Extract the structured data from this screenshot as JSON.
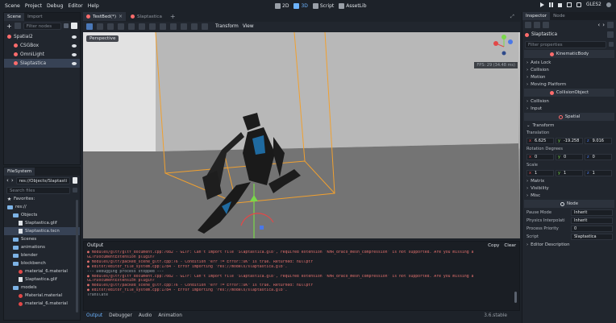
{
  "menu": [
    "Scene",
    "Project",
    "Debug",
    "Editor",
    "Help"
  ],
  "workspaces": [
    {
      "label": "2D",
      "active": false
    },
    {
      "label": "3D",
      "active": true
    },
    {
      "label": "Script",
      "active": false
    },
    {
      "label": "AssetLib",
      "active": false
    }
  ],
  "renderer": "GLES2",
  "scene_dock": {
    "tabs": [
      "Scene",
      "Import"
    ],
    "filter_placeholder": "Filter nodes",
    "tree": [
      {
        "label": "Spatial2",
        "indent": 0,
        "icon_color": "#ff6c6c",
        "selected": false
      },
      {
        "label": "CSGBox",
        "indent": 1,
        "icon_color": "#ff6c6c",
        "selected": false
      },
      {
        "label": "OmniLight",
        "indent": 1,
        "icon_color": "#ff6c6c",
        "selected": false
      },
      {
        "label": "Slaptastica",
        "indent": 1,
        "icon_color": "#ff6c6c",
        "selected": true
      }
    ]
  },
  "filesystem": {
    "tab": "FileSystem",
    "path": "res://Objects/Slaptasti",
    "search_placeholder": "Search files",
    "items": [
      {
        "label": "Favorites:",
        "indent": 0,
        "kind": "star",
        "selected": false
      },
      {
        "label": "res://",
        "indent": 0,
        "kind": "folder",
        "selected": false
      },
      {
        "label": "Objects",
        "indent": 1,
        "kind": "folder",
        "selected": false
      },
      {
        "label": "Slaptastica.glif",
        "indent": 2,
        "kind": "file",
        "selected": false
      },
      {
        "label": "Slaptastica.tscn",
        "indent": 2,
        "kind": "file",
        "selected": true
      },
      {
        "label": "Scenes",
        "indent": 1,
        "kind": "folder",
        "selected": false
      },
      {
        "label": "animations",
        "indent": 1,
        "kind": "folder",
        "selected": false
      },
      {
        "label": "blender",
        "indent": 1,
        "kind": "folder",
        "selected": false
      },
      {
        "label": "blockbench",
        "indent": 1,
        "kind": "folder",
        "selected": false
      },
      {
        "label": "material_6.material",
        "indent": 2,
        "kind": "res",
        "selected": false
      },
      {
        "label": "Slaptastica.glif",
        "indent": 2,
        "kind": "file",
        "selected": false
      },
      {
        "label": "models",
        "indent": 1,
        "kind": "folder",
        "selected": false
      },
      {
        "label": "Material.material",
        "indent": 2,
        "kind": "res",
        "selected": false
      },
      {
        "label": "material_6.material",
        "indent": 2,
        "kind": "res",
        "selected": false
      }
    ]
  },
  "scene_tabs": [
    "TestBed(*)",
    "Slaptastica"
  ],
  "viewport_toolbar": {
    "transform": "Transform",
    "view": "View"
  },
  "viewport": {
    "perspective": "Perspective",
    "fps": "FPS: 29 (34.48 ms)"
  },
  "output": {
    "title": "Output",
    "copy": "Copy",
    "clear": "Clear",
    "lines": [
      {
        "text": "● modules/gltf/gltf_document.cpp:7082 - GLTF: Can't import file 'Slaptastica.glb', required extension 'KHR_draco_mesh_compression' is not supported. Are you missing a",
        "err": true
      },
      {
        "text": "GLTFDocumentExtension plugin?",
        "err": true
      },
      {
        "text": "● modules/gltf/packed_scene_gltf.cpp:76 - Condition \"err != Error::OK\" is true. Returned: nullptr",
        "err": true
      },
      {
        "text": "● editor/editor_file_system.cpp:1784 - Error importing 'res://models/slaptastica.glb'.",
        "err": true
      },
      {
        "text": "--- Debugging process stopped ---",
        "err": false
      },
      {
        "text": "● modules/gltf/gltf_document.cpp:7082 - GLTF: Can't import file 'Slaptastica.glb', required extension 'KHR_draco_mesh_compression' is not supported. Are you missing a",
        "err": true
      },
      {
        "text": "GLTFDocumentExtension plugin?",
        "err": true
      },
      {
        "text": "● modules/gltf/packed_scene_gltf.cpp:76 - Condition \"err != Error::OK\" is true. Returned: nullptr",
        "err": true
      },
      {
        "text": "● editor/editor_file_system.cpp:1784 - Error importing 'res://models/slaptastica.glb'.",
        "err": true
      },
      {
        "text": "Translate",
        "err": false
      }
    ]
  },
  "bottom_tabs": [
    "Output",
    "Debugger",
    "Audio",
    "Animation"
  ],
  "version": "3.6.stable",
  "inspector": {
    "tabs": [
      "Inspector",
      "Node"
    ],
    "object": "Slaptastica",
    "filter_placeholder": "Filter properties",
    "class_header": "KinematicBody",
    "sections1": [
      "Axis Lock",
      "Collision",
      "Motion",
      "Moving Platform"
    ],
    "class_header2": "CollisionObject",
    "sections2": [
      "Collision",
      "Input"
    ],
    "class_header3": "Spatial",
    "transform_label": "Transform",
    "translation_label": "Translation",
    "translation": {
      "x": "6.625",
      "y": "-19.258",
      "z": "9.016"
    },
    "rotation_label": "Rotation Degrees",
    "rotation": {
      "x": "0",
      "y": "0",
      "z": "0"
    },
    "scale_label": "Scale",
    "scale": {
      "x": "1",
      "y": "1",
      "z": "1"
    },
    "sections3": [
      "Matrix",
      "Visibility",
      "Misc"
    ],
    "class_header4": "Node",
    "node_props": [
      {
        "label": "Pause Mode",
        "value": "Inherit"
      },
      {
        "label": "Physics Interpolati",
        "value": "Inherit"
      },
      {
        "label": "Process Priority",
        "value": "0"
      },
      {
        "label": "Script",
        "value": "Slaptastica"
      }
    ],
    "editor_description": "Editor Description"
  }
}
